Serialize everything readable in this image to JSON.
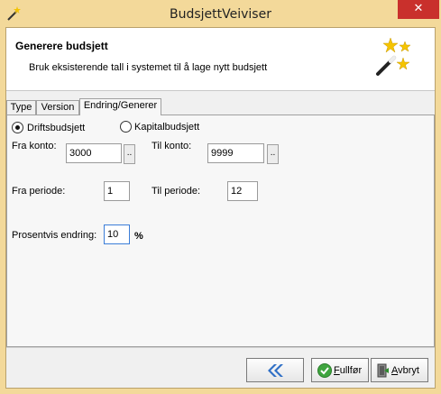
{
  "window": {
    "title": "BudsjettVeiviser",
    "close_glyph": "✕",
    "app_icon": "wand-icon",
    "chrome_color": "#f3d99a",
    "close_color": "#c9302c"
  },
  "header": {
    "title": "Generere budsjett",
    "subtitle": "Bruk eksisterende tall i systemet til å lage nytt budsjett",
    "icon": "magic-wand-stars-icon"
  },
  "tabs": [
    {
      "label": "Type",
      "active": false
    },
    {
      "label": "Version",
      "active": false
    },
    {
      "label": "Endring/Generer",
      "active": true
    }
  ],
  "form": {
    "budget_types": [
      {
        "label": "Driftsbudsjett",
        "checked": true
      },
      {
        "label": "Kapitalbudsjett",
        "checked": false
      }
    ],
    "from_account": {
      "label": "Fra konto:",
      "value": "3000"
    },
    "to_account": {
      "label": "Til konto:",
      "value": "9999"
    },
    "browse_label": "..",
    "from_period": {
      "label": "Fra periode:",
      "value": "1"
    },
    "to_period": {
      "label": "Til periode:",
      "value": "12"
    },
    "percent_change": {
      "label": "Prosentvis endring:",
      "value": "10",
      "unit": "%"
    }
  },
  "buttons": {
    "back_icon": "double-chevron-left-icon",
    "finish_prefix": "",
    "finish_underlined": "F",
    "finish_rest": "ullfør",
    "finish_icon": "green-check-icon",
    "cancel_prefix": "",
    "cancel_underlined": "A",
    "cancel_rest": "vbryt",
    "cancel_icon": "exit-door-icon"
  }
}
